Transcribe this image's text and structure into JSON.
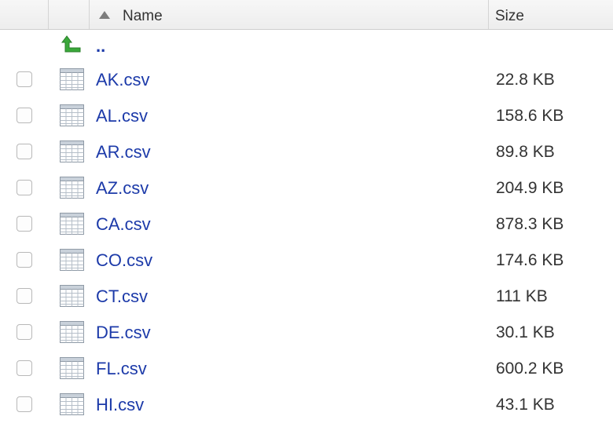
{
  "header": {
    "name_label": "Name",
    "size_label": "Size",
    "sort": "ascending"
  },
  "colors": {
    "link": "#1c3aa9",
    "up_arrow": "#3aa83a",
    "header_bg": "#efefef"
  },
  "parent": {
    "label": "..",
    "icon": "up-arrow-icon"
  },
  "files": [
    {
      "name": "AK.csv",
      "size": "22.8 KB",
      "icon": "spreadsheet-icon"
    },
    {
      "name": "AL.csv",
      "size": "158.6 KB",
      "icon": "spreadsheet-icon"
    },
    {
      "name": "AR.csv",
      "size": "89.8 KB",
      "icon": "spreadsheet-icon"
    },
    {
      "name": "AZ.csv",
      "size": "204.9 KB",
      "icon": "spreadsheet-icon"
    },
    {
      "name": "CA.csv",
      "size": "878.3 KB",
      "icon": "spreadsheet-icon"
    },
    {
      "name": "CO.csv",
      "size": "174.6 KB",
      "icon": "spreadsheet-icon"
    },
    {
      "name": "CT.csv",
      "size": "111 KB",
      "icon": "spreadsheet-icon"
    },
    {
      "name": "DE.csv",
      "size": "30.1 KB",
      "icon": "spreadsheet-icon"
    },
    {
      "name": "FL.csv",
      "size": "600.2 KB",
      "icon": "spreadsheet-icon"
    },
    {
      "name": "HI.csv",
      "size": "43.1 KB",
      "icon": "spreadsheet-icon"
    }
  ]
}
